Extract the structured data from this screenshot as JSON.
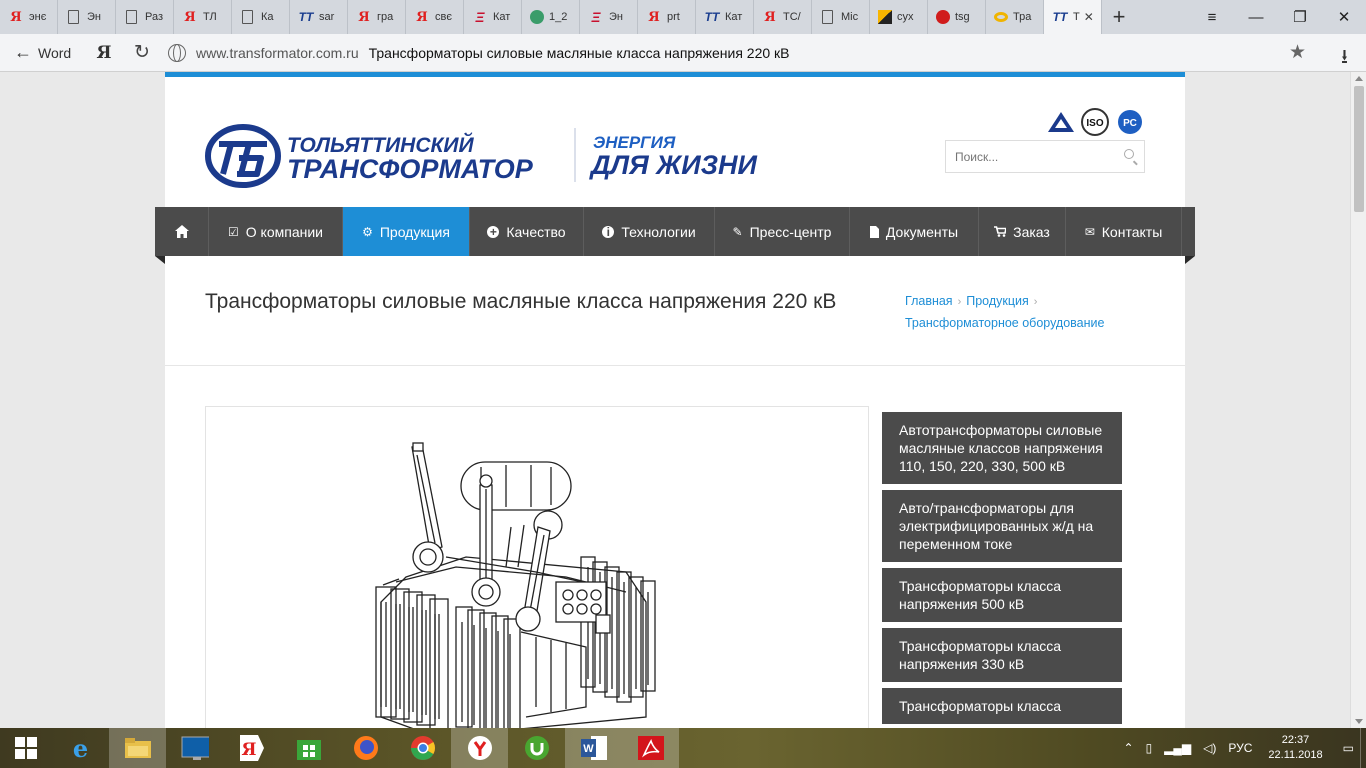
{
  "browser": {
    "tabs": [
      {
        "icon": "yandex-icon",
        "label": "энє"
      },
      {
        "icon": "document-icon",
        "label": "Эн"
      },
      {
        "icon": "document-icon",
        "label": "Раз"
      },
      {
        "icon": "yandex-icon",
        "label": "ТЛ"
      },
      {
        "icon": "document-icon",
        "label": "Ка"
      },
      {
        "icon": "tt-icon",
        "label": "sar"
      },
      {
        "icon": "yandex-icon",
        "label": "гра"
      },
      {
        "icon": "yandex-icon",
        "label": "свє"
      },
      {
        "icon": "ee-icon",
        "label": "Кат"
      },
      {
        "icon": "circle-icon",
        "label": "1_2"
      },
      {
        "icon": "ee-icon",
        "label": "Эн"
      },
      {
        "icon": "yandex-icon",
        "label": "prt"
      },
      {
        "icon": "tt-icon",
        "label": "Кат"
      },
      {
        "icon": "yandex-icon",
        "label": "ТС/"
      },
      {
        "icon": "document-icon",
        "label": "Mic"
      },
      {
        "icon": "warning-icon",
        "label": "сух"
      },
      {
        "icon": "red-circle-icon",
        "label": "tsg"
      },
      {
        "icon": "ring-icon",
        "label": "Тра"
      },
      {
        "icon": "tt-icon",
        "label": "Т"
      }
    ],
    "back_label": "Word",
    "yandex_glyph": "Я",
    "url_domain": "www.transformator.com.ru",
    "page_title": "Трансформаторы силовые масляные класса напряжения 220 кВ",
    "new_tab_glyph": "+",
    "menu_glyph": "≡",
    "minimize_glyph": "—",
    "restore_glyph": "❐",
    "close_glyph": "✕",
    "star_glyph": "★",
    "download_glyph": "⭳",
    "reload_glyph": "↻",
    "back_glyph": "←"
  },
  "site": {
    "accent_color": "#1e8ed6",
    "nav_bg": "#4b4b4b",
    "logo": {
      "line1": "ТОЛЬЯТТИНСКИЙ",
      "line2": "ТРАНСФОРМАТОР",
      "slogan1": "ЭНЕРГИЯ",
      "slogan2": "ДЛЯ ЖИЗНИ"
    },
    "certs": [
      "ISO",
      "РС"
    ],
    "search_placeholder": "Поиск...",
    "nav": [
      {
        "icon": "home-icon",
        "label": ""
      },
      {
        "icon": "check-icon",
        "label": "О компании"
      },
      {
        "icon": "gear-icon",
        "label": "Продукция",
        "active": true
      },
      {
        "icon": "plus-circle-icon",
        "label": "Качество"
      },
      {
        "icon": "info-icon",
        "label": "Технологии"
      },
      {
        "icon": "pencil-icon",
        "label": "Пресс-центр"
      },
      {
        "icon": "file-icon",
        "label": "Документы"
      },
      {
        "icon": "cart-icon",
        "label": "Заказ"
      },
      {
        "icon": "envelope-icon",
        "label": "Контакты"
      }
    ],
    "page_heading": "Трансформаторы силовые масляные класса напряжения 220 кВ",
    "breadcrumb": [
      "Главная",
      "Продукция",
      "Трансформаторное оборудование"
    ],
    "sidebar": [
      "Автотрансформаторы силовые масляные классов напряжения 110, 150, 220, 330, 500 кВ",
      "Авто/трансформаторы для электрифицированных ж/д на переменном токе",
      "Трансформаторы класса напряжения 500 кВ",
      "Трансформаторы класса напряжения 330 кВ",
      "Трансформаторы класса"
    ]
  },
  "taskbar": {
    "apps": [
      "internet-explorer-icon",
      "file-explorer-icon",
      "lenovo-icon",
      "yandex-browser-icon",
      "store-icon",
      "firefox-icon",
      "chrome-icon",
      "yandex-icon",
      "utorrent-icon",
      "word-icon",
      "acrobat-icon"
    ],
    "lang": "РУС",
    "time": "22:37",
    "date": "22.11.2018"
  }
}
